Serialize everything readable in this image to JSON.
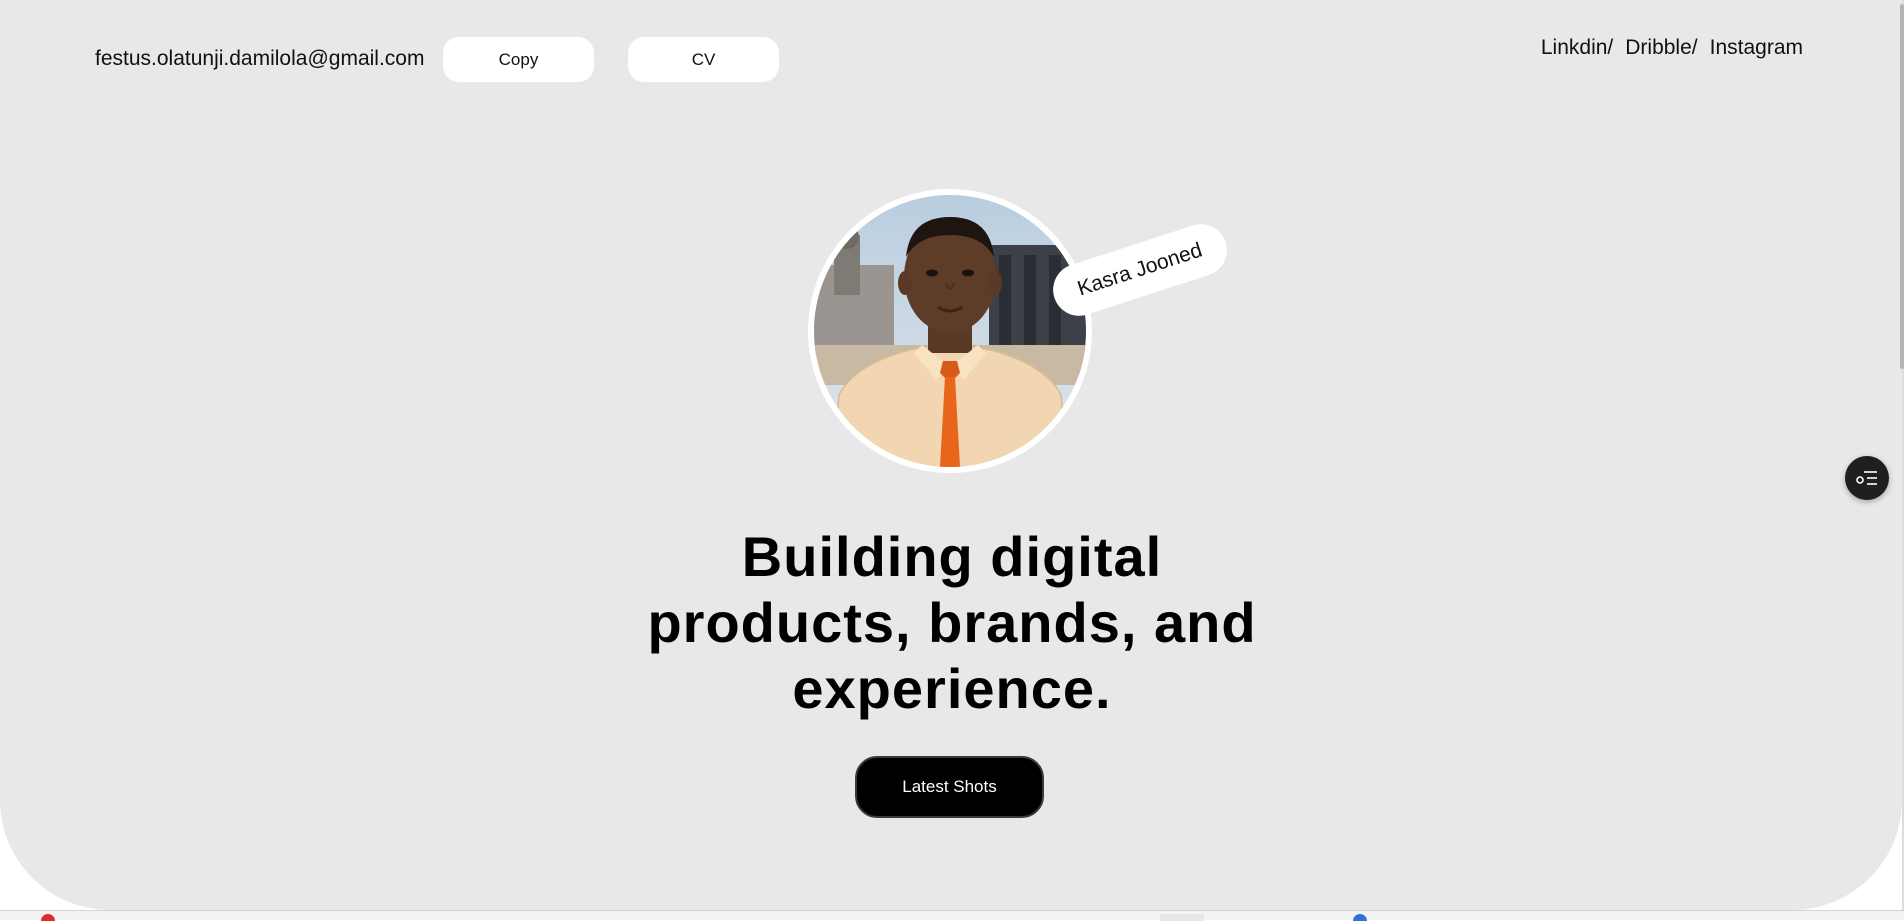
{
  "header": {
    "email": "festus.olatunji.damilola@gmail.com",
    "copy_label": "Copy",
    "cv_label": "CV",
    "social_links": [
      {
        "label": "Linkdin/"
      },
      {
        "label": "Dribble/"
      },
      {
        "label": "Instagram"
      }
    ]
  },
  "hero": {
    "name_tag": "Kasra Jooned",
    "headline_lines": [
      "Building digital",
      "products, brands, and",
      "experience."
    ],
    "cta_label": "Latest Shots"
  },
  "floating_button": {
    "icon": "filter-list-icon"
  },
  "colors": {
    "background": "#e8e8e8",
    "cta_bg": "#000000",
    "tie_orange": "#e8651a"
  }
}
